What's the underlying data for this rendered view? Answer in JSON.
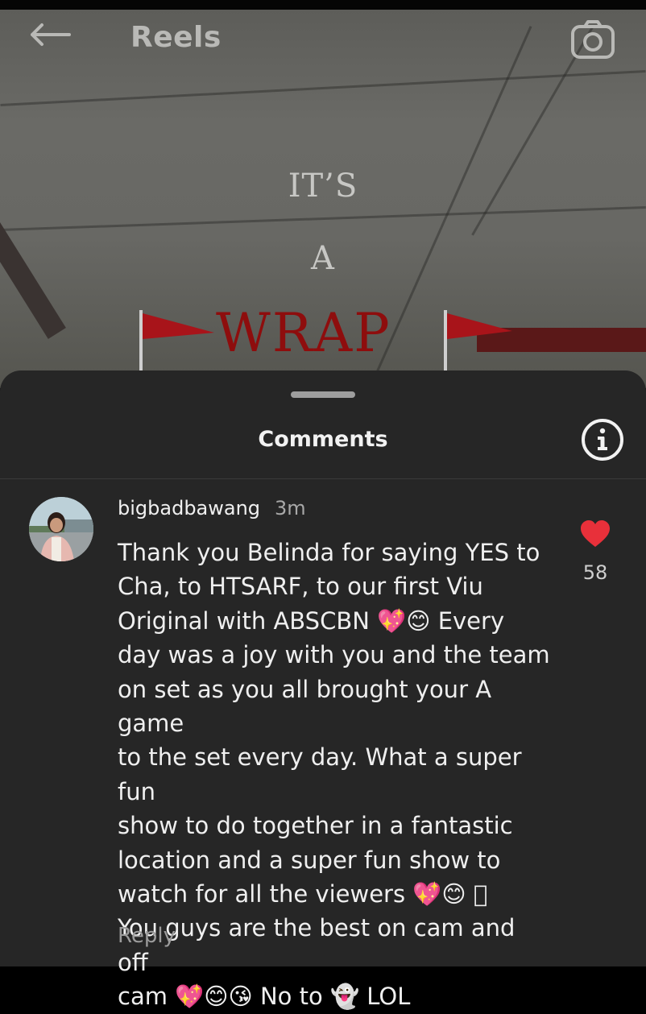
{
  "header": {
    "title": "Reels"
  },
  "reel": {
    "overlay_line1": "IT’S",
    "overlay_line2": "A",
    "overlay_line3": "WRAP"
  },
  "comments_sheet": {
    "title": "Comments",
    "comment": {
      "username": "bigbadbawang",
      "time_ago": "3m",
      "text": "Thank you Belinda for saying YES to\nCha, to HTSARF, to our first Viu\nOriginal with ABSCBN 💖😊 Every\nday was a joy with you and the team\non set as you all brought your A game\nto the set every day. What a super fun\nshow to do together in a fantastic\nlocation and a super fun show to\nwatch for all the viewers 💖😊 🏻\nYou guys are the best on cam and off\ncam 💖😊😘 No to 👻 LOL",
      "like_count": "58",
      "reply_label": "Reply"
    }
  },
  "colors": {
    "sheet_bg": "#262626",
    "like_red": "#e8303a",
    "wrap_red": "#8e0d0d"
  },
  "icons": [
    "back-arrow-icon",
    "camera-icon",
    "info-icon",
    "heart-icon",
    "flag-icon"
  ]
}
